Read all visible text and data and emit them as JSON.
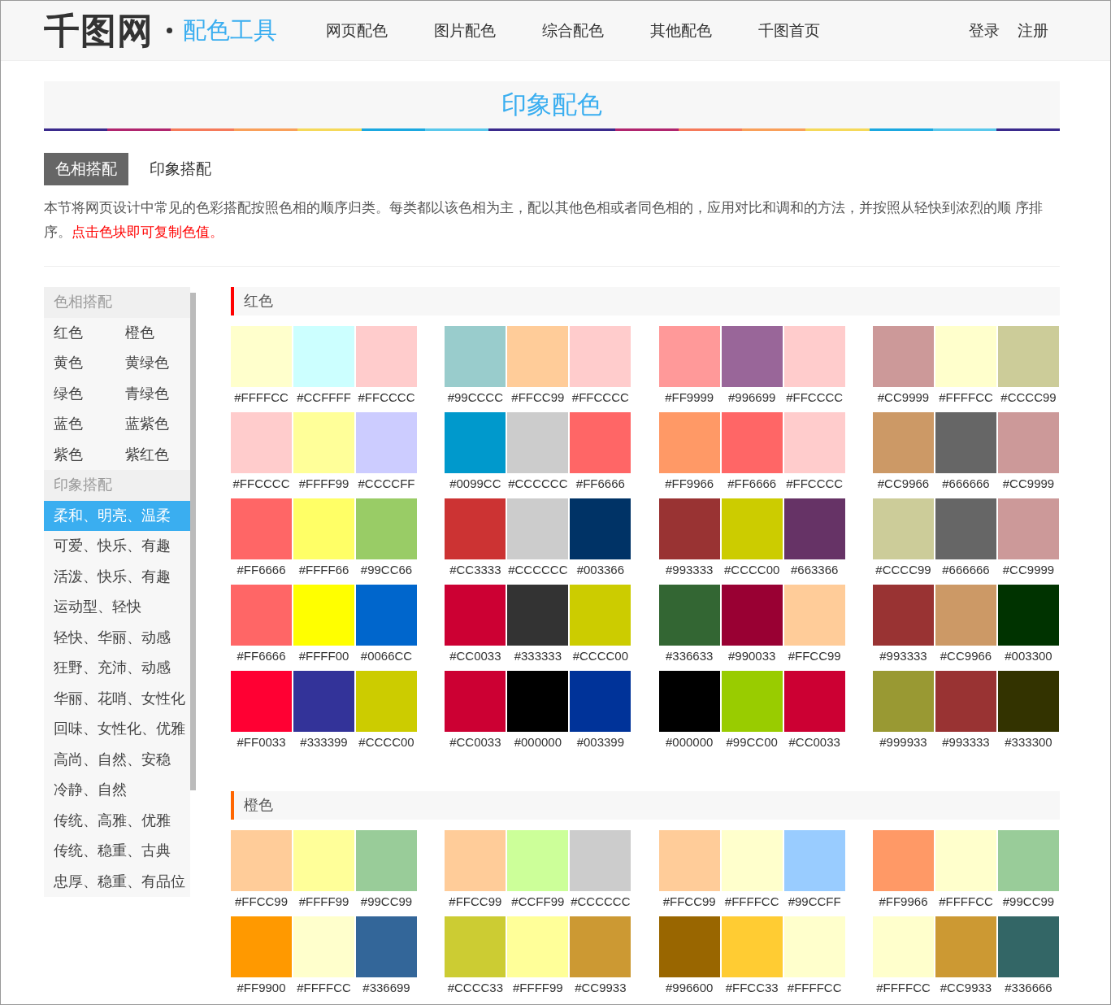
{
  "header": {
    "logo": "千图网",
    "product": "配色工具",
    "nav": [
      "网页配色",
      "图片配色",
      "综合配色",
      "其他配色",
      "千图首页"
    ],
    "account": [
      "登录",
      "注册"
    ]
  },
  "page_title": "印象配色",
  "tabs": [
    {
      "label": "色相搭配",
      "selected": true
    },
    {
      "label": "印象搭配",
      "selected": false
    }
  ],
  "description": {
    "text": "本节将网页设计中常见的色彩搭配按照色相的顺序归类。每类都以该色相为主，配以其他色相或者同色相的，应用对比和调和的方法，并按照从轻快到浓烈的顺 序排序。",
    "note": "点击色块即可复制色值。"
  },
  "sidebar": [
    {
      "title": "色相搭配",
      "kind": "grid",
      "items": [
        {
          "label": "红色",
          "selected": false
        },
        {
          "label": "橙色",
          "selected": false
        },
        {
          "label": "黄色",
          "selected": false
        },
        {
          "label": "黄绿色",
          "selected": false
        },
        {
          "label": "绿色",
          "selected": false
        },
        {
          "label": "青绿色",
          "selected": false
        },
        {
          "label": "蓝色",
          "selected": false
        },
        {
          "label": "蓝紫色",
          "selected": false
        },
        {
          "label": "紫色",
          "selected": false
        },
        {
          "label": "紫红色",
          "selected": false
        }
      ]
    },
    {
      "title": "印象搭配",
      "kind": "list",
      "items": [
        {
          "label": "柔和、明亮、温柔",
          "selected": true
        },
        {
          "label": "可爱、快乐、有趣",
          "selected": false
        },
        {
          "label": "活泼、快乐、有趣",
          "selected": false
        },
        {
          "label": "运动型、轻快",
          "selected": false
        },
        {
          "label": "轻快、华丽、动感",
          "selected": false
        },
        {
          "label": "狂野、充沛、动感",
          "selected": false
        },
        {
          "label": "华丽、花哨、女性化",
          "selected": false
        },
        {
          "label": "回味、女性化、优雅",
          "selected": false
        },
        {
          "label": "高尚、自然、安稳",
          "selected": false
        },
        {
          "label": "冷静、自然",
          "selected": false
        },
        {
          "label": "传统、高雅、优雅",
          "selected": false
        },
        {
          "label": "传统、稳重、古典",
          "selected": false
        },
        {
          "label": "忠厚、稳重、有品位",
          "selected": false
        }
      ]
    }
  ],
  "sections": [
    {
      "title": "红色",
      "color": "#ff0000",
      "palettes": [
        [
          {
            "code": "#FFFFCC",
            "color": "#ffffcc"
          },
          {
            "code": "#CCFFFF",
            "color": "#ccffff"
          },
          {
            "code": "#FFCCCC",
            "color": "#ffcccc"
          }
        ],
        [
          {
            "code": "#99CCCC",
            "color": "#99cccc"
          },
          {
            "code": "#FFCC99",
            "color": "#ffcc99"
          },
          {
            "code": "#FFCCCC",
            "color": "#ffcccc"
          }
        ],
        [
          {
            "code": "#FF9999",
            "color": "#ff9999"
          },
          {
            "code": "#996699",
            "color": "#996699"
          },
          {
            "code": "#FFCCCC",
            "color": "#ffcccc"
          }
        ],
        [
          {
            "code": "#CC9999",
            "color": "#cc9999"
          },
          {
            "code": "#FFFFCC",
            "color": "#ffffcc"
          },
          {
            "code": "#CCCC99",
            "color": "#cccc99"
          }
        ],
        [
          {
            "code": "#FFCCCC",
            "color": "#ffcccc"
          },
          {
            "code": "#FFFF99",
            "color": "#ffff99"
          },
          {
            "code": "#CCCCFF",
            "color": "#ccccff"
          }
        ],
        [
          {
            "code": "#0099CC",
            "color": "#0099cc"
          },
          {
            "code": "#CCCCCC",
            "color": "#cccccc"
          },
          {
            "code": "#FF6666",
            "color": "#ff6666"
          }
        ],
        [
          {
            "code": "#FF9966",
            "color": "#ff9966"
          },
          {
            "code": "#FF6666",
            "color": "#ff6666"
          },
          {
            "code": "#FFCCCC",
            "color": "#ffcccc"
          }
        ],
        [
          {
            "code": "#CC9966",
            "color": "#cc9966"
          },
          {
            "code": "#666666",
            "color": "#666666"
          },
          {
            "code": "#CC9999",
            "color": "#cc9999"
          }
        ],
        [
          {
            "code": "#FF6666",
            "color": "#ff6666"
          },
          {
            "code": "#FFFF66",
            "color": "#ffff66"
          },
          {
            "code": "#99CC66",
            "color": "#99cc66"
          }
        ],
        [
          {
            "code": "#CC3333",
            "color": "#cc3333"
          },
          {
            "code": "#CCCCCC",
            "color": "#cccccc"
          },
          {
            "code": "#003366",
            "color": "#003366"
          }
        ],
        [
          {
            "code": "#993333",
            "color": "#993333"
          },
          {
            "code": "#CCCC00",
            "color": "#cccc00"
          },
          {
            "code": "#663366",
            "color": "#663366"
          }
        ],
        [
          {
            "code": "#CCCC99",
            "color": "#cccc99"
          },
          {
            "code": "#666666",
            "color": "#666666"
          },
          {
            "code": "#CC9999",
            "color": "#cc9999"
          }
        ],
        [
          {
            "code": "#FF6666",
            "color": "#ff6666"
          },
          {
            "code": "#FFFF00",
            "color": "#ffff00"
          },
          {
            "code": "#0066CC",
            "color": "#0066cc"
          }
        ],
        [
          {
            "code": "#CC0033",
            "color": "#cc0033"
          },
          {
            "code": "#333333",
            "color": "#333333"
          },
          {
            "code": "#CCCC00",
            "color": "#cccc00"
          }
        ],
        [
          {
            "code": "#336633",
            "color": "#336633"
          },
          {
            "code": "#990033",
            "color": "#990033"
          },
          {
            "code": "#FFCC99",
            "color": "#ffcc99"
          }
        ],
        [
          {
            "code": "#993333",
            "color": "#993333"
          },
          {
            "code": "#CC9966",
            "color": "#cc9966"
          },
          {
            "code": "#003300",
            "color": "#003300"
          }
        ],
        [
          {
            "code": "#FF0033",
            "color": "#ff0033"
          },
          {
            "code": "#333399",
            "color": "#333399"
          },
          {
            "code": "#CCCC00",
            "color": "#cccc00"
          }
        ],
        [
          {
            "code": "#CC0033",
            "color": "#cc0033"
          },
          {
            "code": "#000000",
            "color": "#000000"
          },
          {
            "code": "#003399",
            "color": "#003399"
          }
        ],
        [
          {
            "code": "#000000",
            "color": "#000000"
          },
          {
            "code": "#99CC00",
            "color": "#99cc00"
          },
          {
            "code": "#CC0033",
            "color": "#cc0033"
          }
        ],
        [
          {
            "code": "#999933",
            "color": "#999933"
          },
          {
            "code": "#993333",
            "color": "#993333"
          },
          {
            "code": "#333300",
            "color": "#333300"
          }
        ]
      ]
    },
    {
      "title": "橙色",
      "color": "#ff6600",
      "palettes": [
        [
          {
            "code": "#FFCC99",
            "color": "#ffcc99"
          },
          {
            "code": "#FFFF99",
            "color": "#ffff99"
          },
          {
            "code": "#99CC99",
            "color": "#99cc99"
          }
        ],
        [
          {
            "code": "#FFCC99",
            "color": "#ffcc99"
          },
          {
            "code": "#CCFF99",
            "color": "#ccff99"
          },
          {
            "code": "#CCCCCC",
            "color": "#cccccc"
          }
        ],
        [
          {
            "code": "#FFCC99",
            "color": "#ffcc99"
          },
          {
            "code": "#FFFFCC",
            "color": "#ffffcc"
          },
          {
            "code": "#99CCFF",
            "color": "#99ccff"
          }
        ],
        [
          {
            "code": "#FF9966",
            "color": "#ff9966"
          },
          {
            "code": "#FFFFCC",
            "color": "#ffffcc"
          },
          {
            "code": "#99CC99",
            "color": "#99cc99"
          }
        ],
        [
          {
            "code": "#FF9900",
            "color": "#ff9900"
          },
          {
            "code": "#FFFFCC",
            "color": "#ffffcc"
          },
          {
            "code": "#336699",
            "color": "#336699"
          }
        ],
        [
          {
            "code": "#CCCC33",
            "color": "#cccc33"
          },
          {
            "code": "#FFFF99",
            "color": "#ffff99"
          },
          {
            "code": "#CC9933",
            "color": "#cc9933"
          }
        ],
        [
          {
            "code": "#996600",
            "color": "#996600"
          },
          {
            "code": "#FFCC33",
            "color": "#ffcc33"
          },
          {
            "code": "#FFFFCC",
            "color": "#ffffcc"
          }
        ],
        [
          {
            "code": "#FFFFCC",
            "color": "#ffffcc"
          },
          {
            "code": "#CC9933",
            "color": "#cc9933"
          },
          {
            "code": "#336666",
            "color": "#336666"
          }
        ]
      ]
    }
  ]
}
